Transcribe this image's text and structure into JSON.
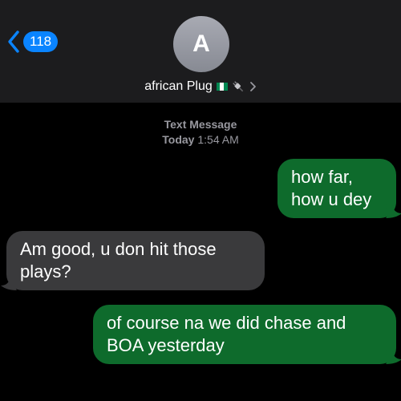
{
  "header": {
    "back_badge": "118",
    "avatar_initial": "A",
    "contact_name": "african Plug"
  },
  "conversation": {
    "service": "Text Message",
    "date": "Today",
    "time": "1:54 AM"
  },
  "messages": [
    {
      "direction": "sent",
      "text": "how far,\nhow u dey"
    },
    {
      "direction": "received",
      "text": "Am good, u don hit those plays?"
    },
    {
      "direction": "sent",
      "text": "of course na we did chase and BOA yesterday"
    }
  ],
  "icons": {
    "back": "chevron-left-icon",
    "flag": "nigeria-flag-icon",
    "plug": "electric-plug-icon",
    "disclosure": "chevron-right-icon"
  },
  "colors": {
    "accent": "#0a84ff",
    "sent_bubble": "#0e6b2c",
    "received_bubble": "#3a3a3c",
    "header_background": "#1c1c1e",
    "background": "#000000",
    "flag_green": "#008751"
  }
}
